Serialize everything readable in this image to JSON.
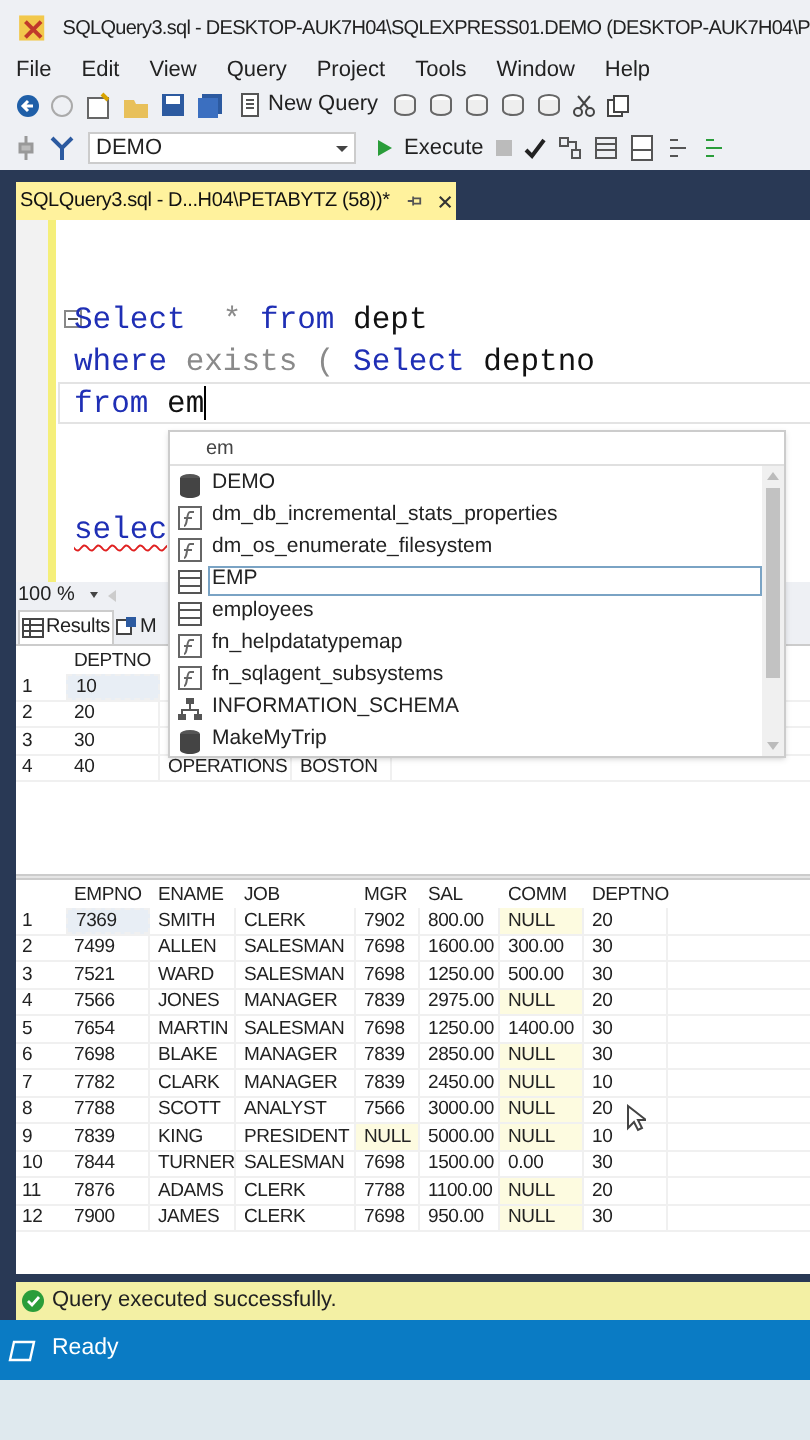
{
  "window": {
    "title": "SQLQuery3.sql - DESKTOP-AUK7H04\\SQLEXPRESS01.DEMO (DESKTOP-AUK7H04\\P"
  },
  "menu": [
    "File",
    "Edit",
    "View",
    "Query",
    "Project",
    "Tools",
    "Window",
    "Help"
  ],
  "toolbar": {
    "new_query": "New Query",
    "database": "DEMO",
    "execute": "Execute"
  },
  "document_tab": {
    "title": "SQLQuery3.sql - D...H04\\PETABYTZ (58))*",
    "selected": true
  },
  "editor": {
    "lines": [
      {
        "tokens": [
          {
            "text": "Select",
            "kind": "keyword"
          },
          {
            "text": "  * ",
            "kind": "operator"
          },
          {
            "text": "from",
            "kind": "keyword"
          },
          {
            "text": " dept",
            "kind": "plain"
          }
        ],
        "current": false,
        "error": false
      },
      {
        "tokens": [
          {
            "text": "where",
            "kind": "keyword"
          },
          {
            "text": " exists ( ",
            "kind": "operator"
          },
          {
            "text": "Select",
            "kind": "keyword"
          },
          {
            "text": " deptno",
            "kind": "plain"
          }
        ],
        "current": false,
        "error": false
      },
      {
        "tokens": [
          {
            "text": "from",
            "kind": "keyword"
          },
          {
            "text": " em",
            "kind": "plain"
          }
        ],
        "current": true,
        "error": false
      },
      {
        "current": false,
        "error": false
      },
      {
        "current": false,
        "error": false
      },
      {
        "tokens": [
          {
            "text": "selec",
            "kind": "keyword"
          }
        ],
        "current": false,
        "error": true
      }
    ]
  },
  "autocomplete": {
    "filter": "em",
    "items": [
      {
        "label": "DEMO",
        "kind": "database",
        "selected": false
      },
      {
        "label": "dm_db_incremental_stats_properties",
        "kind": "function",
        "selected": false
      },
      {
        "label": "dm_os_enumerate_filesystem",
        "kind": "function",
        "selected": false
      },
      {
        "label": "EMP",
        "kind": "table",
        "selected": true
      },
      {
        "label": "employees",
        "kind": "table",
        "selected": false
      },
      {
        "label": "fn_helpdatatypemap",
        "kind": "function",
        "selected": false
      },
      {
        "label": "fn_sqlagent_subsystems",
        "kind": "function",
        "selected": false
      },
      {
        "label": "INFORMATION_SCHEMA",
        "kind": "schema",
        "selected": false
      },
      {
        "label": "MakeMyTrip",
        "kind": "database",
        "selected": false
      }
    ]
  },
  "zoom": "100 %",
  "result_tabs": [
    {
      "label": "Results",
      "selected": true
    },
    {
      "label": "M",
      "selected": false
    }
  ],
  "result_grid_1": {
    "columns": [
      "DEPTNO"
    ],
    "rows": [
      {
        "number": "1",
        "cells": [
          "10"
        ],
        "selected": true
      },
      {
        "number": "2",
        "cells": [
          "20"
        ],
        "selected": false
      },
      {
        "number": "3",
        "cells": [
          "30"
        ],
        "selected": false
      },
      {
        "number": "4",
        "cells": [
          "40",
          "OPERATIONS",
          "BOSTON"
        ],
        "selected": false
      }
    ]
  },
  "result_grid_2": {
    "columns": [
      "EMPNO",
      "ENAME",
      "JOB",
      "MGR",
      "SAL",
      "COMM",
      "DEPTNO"
    ],
    "rows": [
      {
        "number": "1",
        "cells": [
          "7369",
          "SMITH",
          "CLERK",
          "7902",
          "800.00",
          {
            "text": "NULL",
            "kind": "null"
          },
          "20"
        ],
        "selected": true
      },
      {
        "number": "2",
        "cells": [
          "7499",
          "ALLEN",
          "SALESMAN",
          "7698",
          "1600.00",
          "300.00",
          "30"
        ],
        "selected": false
      },
      {
        "number": "3",
        "cells": [
          "7521",
          "WARD",
          "SALESMAN",
          "7698",
          "1250.00",
          "500.00",
          "30"
        ],
        "selected": false
      },
      {
        "number": "4",
        "cells": [
          "7566",
          "JONES",
          "MANAGER",
          "7839",
          "2975.00",
          {
            "text": "NULL",
            "kind": "null"
          },
          "20"
        ],
        "selected": false
      },
      {
        "number": "5",
        "cells": [
          "7654",
          "MARTIN",
          "SALESMAN",
          "7698",
          "1250.00",
          "1400.00",
          "30"
        ],
        "selected": false
      },
      {
        "number": "6",
        "cells": [
          "7698",
          "BLAKE",
          "MANAGER",
          "7839",
          "2850.00",
          {
            "text": "NULL",
            "kind": "null"
          },
          "30"
        ],
        "selected": false
      },
      {
        "number": "7",
        "cells": [
          "7782",
          "CLARK",
          "MANAGER",
          "7839",
          "2450.00",
          {
            "text": "NULL",
            "kind": "null"
          },
          "10"
        ],
        "selected": false
      },
      {
        "number": "8",
        "cells": [
          "7788",
          "SCOTT",
          "ANALYST",
          "7566",
          "3000.00",
          {
            "text": "NULL",
            "kind": "null"
          },
          "20"
        ],
        "selected": false
      },
      {
        "number": "9",
        "cells": [
          "7839",
          "KING",
          "PRESIDENT",
          {
            "text": "NULL",
            "kind": "null"
          },
          "5000.00",
          {
            "text": "NULL",
            "kind": "null"
          },
          "10"
        ],
        "selected": false
      },
      {
        "number": "10",
        "cells": [
          "7844",
          "TURNER",
          "SALESMAN",
          "7698",
          "1500.00",
          "0.00",
          "30"
        ],
        "selected": false
      },
      {
        "number": "11",
        "cells": [
          "7876",
          "ADAMS",
          "CLERK",
          "7788",
          "1100.00",
          {
            "text": "NULL",
            "kind": "null"
          },
          "20"
        ],
        "selected": false
      },
      {
        "number": "12",
        "cells": [
          "7900",
          "JAMES",
          "CLERK",
          "7698",
          "950.00",
          {
            "text": "NULL",
            "kind": "null"
          },
          "30"
        ],
        "selected": false
      }
    ]
  },
  "query_status": "Query executed successfully.",
  "status_bar": "Ready"
}
